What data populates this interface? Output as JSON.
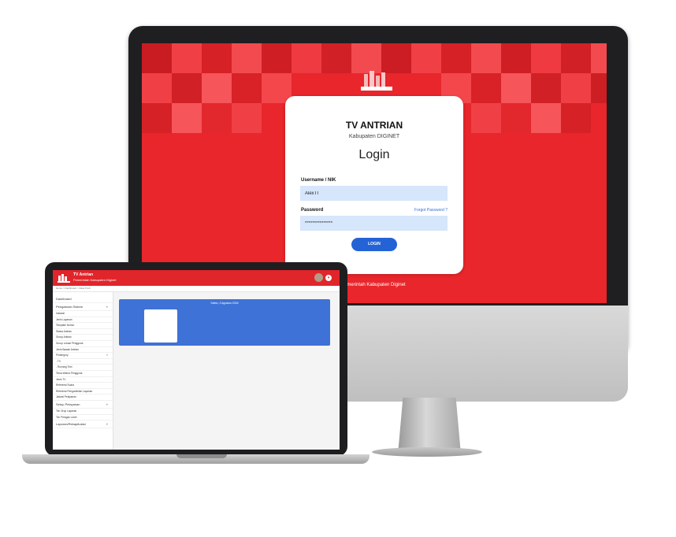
{
  "monitor": {
    "login": {
      "title": "TV ANTRIAN",
      "subtitle": "Kabupaten DIGINET",
      "heading": "Login",
      "username_label": "Username / NIK",
      "username_value": "AlexTI",
      "password_label": "Password",
      "forgot_label": "Forgot Password ?",
      "password_value": "***************",
      "button_label": "LOGIN"
    },
    "footer_text": "Pemerintah Kabupaten Diginet",
    "accent_color": "#e8262b",
    "button_color": "#2463d6"
  },
  "laptop": {
    "header": {
      "title": "TV Antrian",
      "subtitle": "Pemerintah Kabupaten Diginet"
    },
    "breadcrumb": "Home  >  Dashboard  >  Data Prodi",
    "sidebar": [
      {
        "label": "Dashboard",
        "big": true
      },
      {
        "label": "Pengaturan Sistem",
        "big": true,
        "chevron": "^"
      },
      {
        "label": "Instansi"
      },
      {
        "label": "Jenis Layanan"
      },
      {
        "label": "Template Nomor"
      },
      {
        "label": "Status Antrian"
      },
      {
        "label": "Group Antrian"
      },
      {
        "label": "Group Lokasi Pengguna"
      },
      {
        "label": "Jenis Bawah Antrian"
      },
      {
        "label": "Printergory",
        "chevron": "^"
      },
      {
        "label": "- TV"
      },
      {
        "label": "- Running Text"
      },
      {
        "label": "Tema Warna Pengguna"
      },
      {
        "label": "Jenis TV"
      },
      {
        "label": "Referensi Suara"
      },
      {
        "label": "Referensi Pengambilan Layanan"
      },
      {
        "label": "Jadwal Pelayanan"
      },
      {
        "label": "Setup Pelayanan",
        "big": true,
        "chevron": "v"
      },
      {
        "label": "Tim Grup Layanan"
      },
      {
        "label": "Tim Petugas Loket"
      },
      {
        "label": "Laporan/Rekapitulasi",
        "big": true,
        "chevron": "v"
      }
    ],
    "banner_date": "Sabtu, 3 Agustus 2024"
  }
}
